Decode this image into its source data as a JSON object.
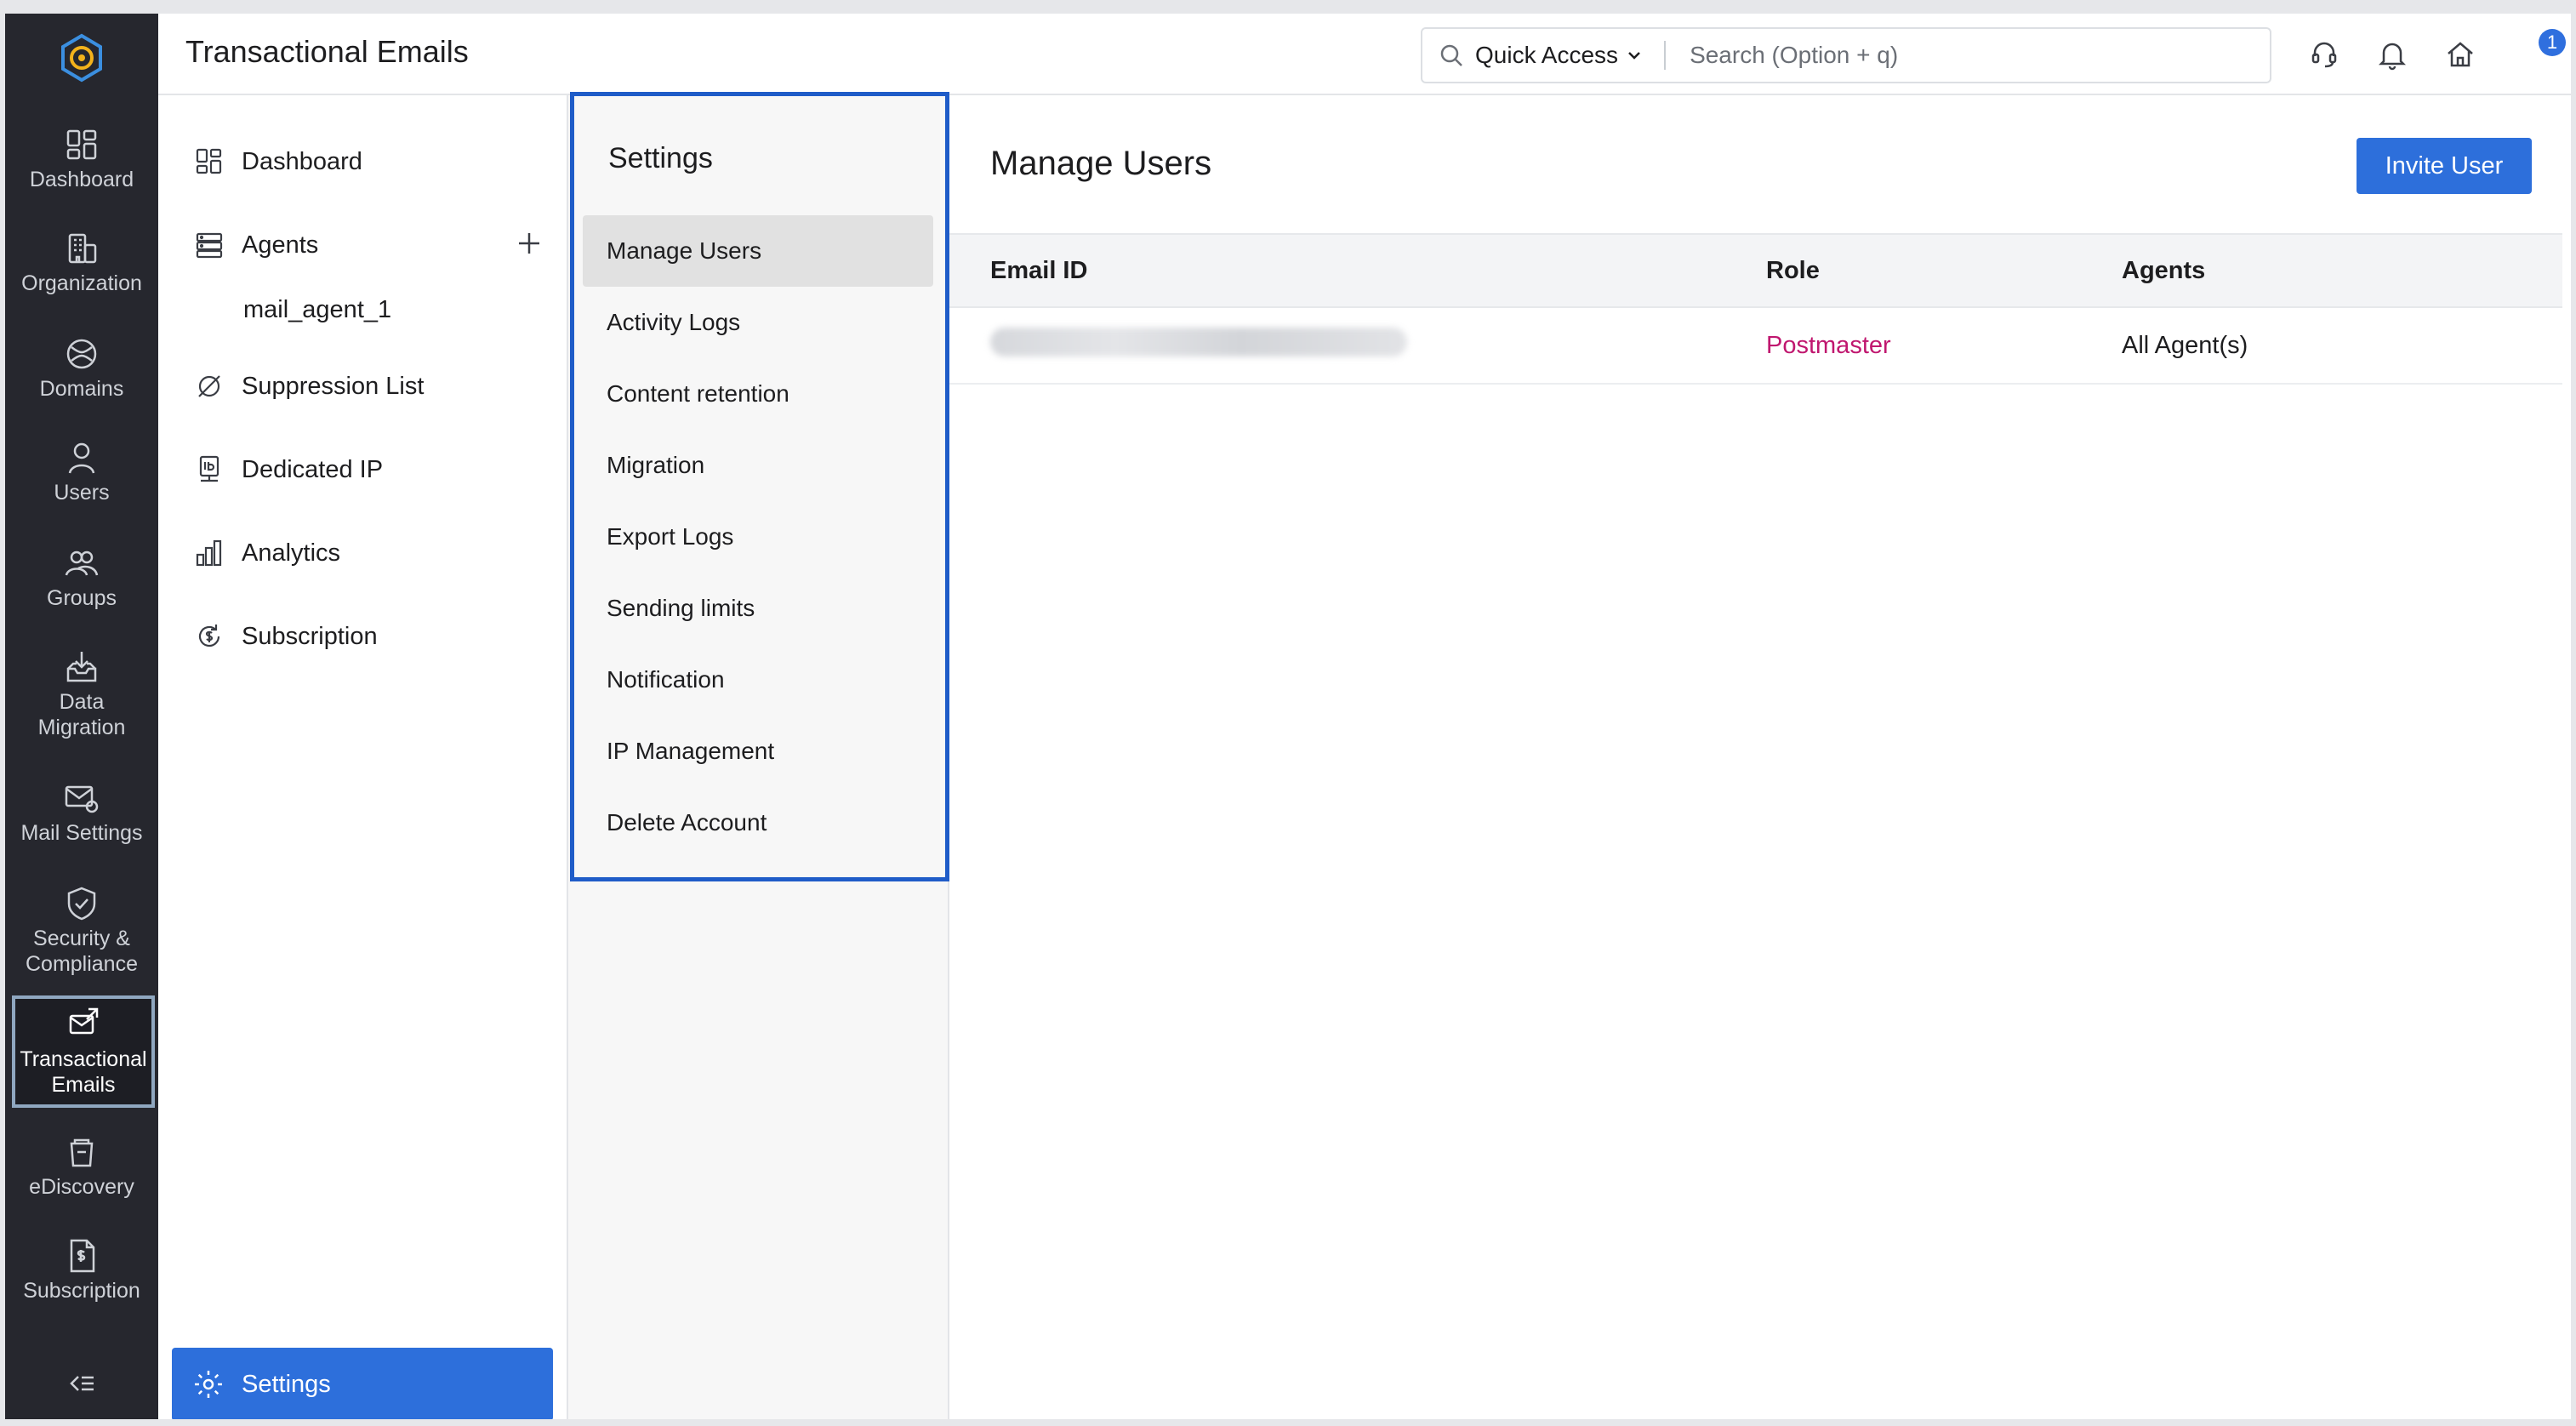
{
  "rail": {
    "items": [
      {
        "label": "Dashboard",
        "icon": "dashboard-icon"
      },
      {
        "label": "Organization",
        "icon": "organization-icon"
      },
      {
        "label": "Domains",
        "icon": "domains-icon"
      },
      {
        "label": "Users",
        "icon": "users-icon"
      },
      {
        "label": "Groups",
        "icon": "groups-icon"
      },
      {
        "label": "Data Migration",
        "icon": "data-migration-icon"
      },
      {
        "label": "Mail Settings",
        "icon": "mail-settings-icon"
      },
      {
        "label": "Security & Compliance",
        "icon": "security-icon"
      },
      {
        "label": "Transactional Emails",
        "icon": "transactional-emails-icon",
        "active": true
      },
      {
        "label": "eDiscovery",
        "icon": "ediscovery-icon"
      },
      {
        "label": "Subscription",
        "icon": "subscription-icon"
      }
    ]
  },
  "header": {
    "title": "Transactional Emails",
    "quick_access": "Quick Access",
    "search_placeholder": "Search (Option + q)",
    "notification_count": "1"
  },
  "subnav": {
    "dashboard": "Dashboard",
    "agents": "Agents",
    "agent_child": "mail_agent_1",
    "suppression": "Suppression List",
    "dedicated_ip": "Dedicated IP",
    "analytics": "Analytics",
    "subscription": "Subscription",
    "settings": "Settings"
  },
  "settings_menu": {
    "title": "Settings",
    "items": [
      "Manage Users",
      "Activity Logs",
      "Content retention",
      "Migration",
      "Export Logs",
      "Sending limits",
      "Notification",
      "IP Management",
      "Delete Account"
    ],
    "active_index": 0
  },
  "main": {
    "title": "Manage Users",
    "invite_button": "Invite User",
    "columns": [
      "Email ID",
      "Role",
      "Agents"
    ],
    "rows": [
      {
        "email": "",
        "role": "Postmaster",
        "agents": "All Agent(s)"
      }
    ]
  },
  "colors": {
    "primary": "#2d6fdb",
    "rail_bg": "#26272e",
    "role_text": "#c0176f",
    "highlight_border": "#1f5cc8"
  }
}
